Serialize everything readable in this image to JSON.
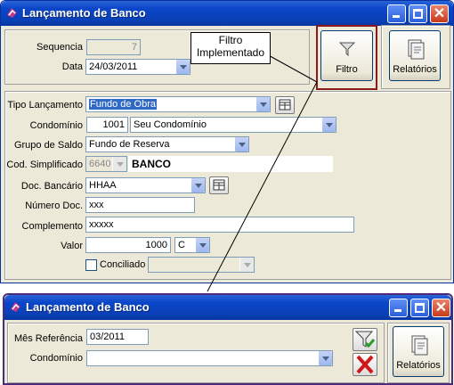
{
  "top_window": {
    "title": "Lançamento de Banco",
    "sequencia_label": "Sequencia",
    "sequencia_value": "7",
    "data_label": "Data",
    "data_value": "24/03/2011",
    "filtro_label": "Filtro",
    "relatorios_label": "Relatórios",
    "tipo_lancamento_label": "Tipo Lançamento",
    "tipo_lancamento_value": "Fundo de Obra",
    "condominio_label": "Condomínio",
    "condominio_code": "1001",
    "condominio_name": "Seu Condomínio",
    "grupo_saldo_label": "Grupo de Saldo",
    "grupo_saldo_value": "Fundo de Reserva",
    "cod_simplificado_label": "Cod. Simplificado",
    "cod_simplificado_value": "6640",
    "cod_simplificado_desc": "BANCO",
    "doc_bancario_label": "Doc. Bancário",
    "doc_bancario_value": "HHAA",
    "numero_doc_label": "Número Doc.",
    "numero_doc_value": "xxx",
    "complemento_label": "Complemento",
    "complemento_value": "xxxxx",
    "valor_label": "Valor",
    "valor_value": "1000",
    "valor_type": "C",
    "conciliado_label": "Conciliado"
  },
  "annotation": {
    "text": "Filtro Implementado"
  },
  "bottom_window": {
    "title": "Lançamento de Banco",
    "mes_referencia_label": "Mês Referência",
    "mes_referencia_value": "03/2011",
    "condominio_label": "Condomínio",
    "condominio_value": "",
    "relatorios_label": "Relatórios"
  },
  "colors": {
    "titlebar": "#0a46c8",
    "window_bg": "#ece9d8",
    "highlight_border": "#8b1a1a",
    "selection": "#316ac5"
  }
}
